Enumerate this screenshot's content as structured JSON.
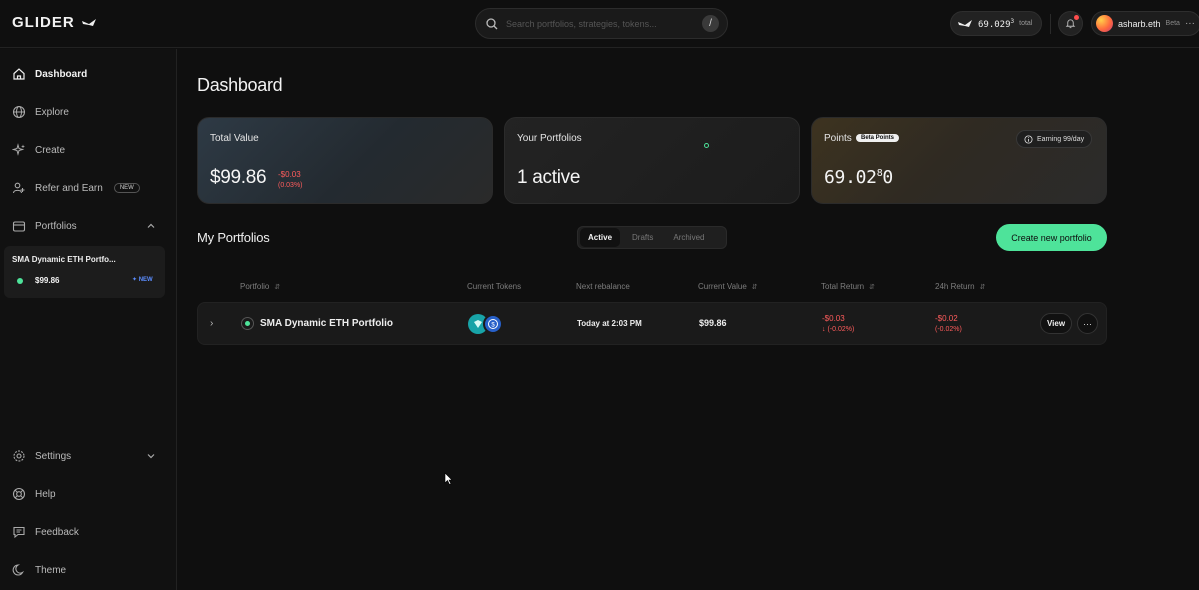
{
  "brand": {
    "name": "GLIDER"
  },
  "search": {
    "placeholder": "Search portfolios, strategies, tokens...",
    "shortcut": "/"
  },
  "header": {
    "points_value": "69.029",
    "points_sup": "3",
    "points_suffix": "total",
    "username": "asharb.eth",
    "user_tag": "Beta",
    "more": "···"
  },
  "sidebar": {
    "items": [
      {
        "label": "Dashboard",
        "icon": "home-icon"
      },
      {
        "label": "Explore",
        "icon": "globe-icon"
      },
      {
        "label": "Create",
        "icon": "sparkles-icon"
      },
      {
        "label": "Refer and Earn",
        "icon": "users-icon",
        "badge": "NEW"
      },
      {
        "label": "Portfolios",
        "icon": "wallet-icon"
      },
      {
        "label": "Settings",
        "icon": "gear-icon"
      },
      {
        "label": "Help",
        "icon": "lifebuoy-icon"
      },
      {
        "label": "Feedback",
        "icon": "message-icon"
      },
      {
        "label": "Theme",
        "icon": "moon-icon"
      }
    ],
    "portfolio_card": {
      "name": "SMA Dynamic ETH Portfo...",
      "value": "$99.86",
      "badge": "NEW"
    }
  },
  "page": {
    "title": "Dashboard"
  },
  "cards": {
    "total_value": {
      "label": "Total Value",
      "value": "$99.86",
      "delta": "-$0.03",
      "delta_pct": "(0.03%)"
    },
    "portfolios": {
      "label": "Your Portfolios",
      "value": "1 active"
    },
    "points": {
      "label": "Points",
      "badge": "Beta Points",
      "earning": "Earning 99/day",
      "value": "69.02",
      "value_sup": "8",
      "value_tail": "0"
    }
  },
  "my_portfolios": {
    "title": "My Portfolios",
    "tabs": [
      "Active",
      "Drafts",
      "Archived"
    ],
    "active_tab": "Active",
    "create_button": "Create new portfolio",
    "columns": [
      "Portfolio",
      "Current Tokens",
      "Next rebalance",
      "Current Value",
      "Total Return",
      "24h Return"
    ],
    "rows": [
      {
        "name": "SMA Dynamic ETH Portfolio",
        "tokens": [
          "pendle-icon",
          "usdc-icon"
        ],
        "next_rebalance": "Today at 2:03 PM",
        "current_value": "$99.86",
        "total_return": "-$0.03",
        "total_return_pct": "(-0.02%)",
        "day_return": "-$0.02",
        "day_return_pct": "(-0.02%)",
        "view_label": "View",
        "more_label": "···"
      }
    ]
  },
  "colors": {
    "accent": "#4ee39a",
    "negative": "#ff5c5c",
    "background": "#0f0f0f"
  }
}
